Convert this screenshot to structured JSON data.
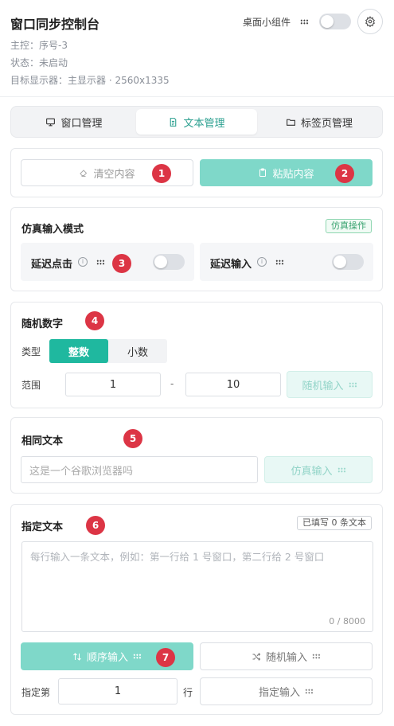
{
  "header": {
    "title": "窗口同步控制台",
    "master": "主控：序号-3",
    "status": "状态：未启动",
    "display": "目标显示器：主显示器 · 2560x1335",
    "widget_label": "桌面小组件"
  },
  "tabs": [
    {
      "label": "窗口管理",
      "icon": "monitor-icon"
    },
    {
      "label": "文本管理",
      "icon": "document-icon",
      "active": true
    },
    {
      "label": "标签页管理",
      "icon": "folder-icon"
    }
  ],
  "actions": {
    "clear_label": "清空内容",
    "paste_label": "粘贴内容"
  },
  "sim_mode": {
    "title": "仿真输入模式",
    "tag": "仿真操作",
    "delay_click": "延迟点击",
    "delay_input": "延迟输入"
  },
  "random_number": {
    "title": "随机数字",
    "type_label": "类型",
    "opt_int": "整数",
    "opt_dec": "小数",
    "range_label": "范围",
    "min": "1",
    "dash": "-",
    "max": "10",
    "button": "随机输入"
  },
  "same_text": {
    "title": "相同文本",
    "placeholder": "这是一个谷歌浏览器吗",
    "button": "仿真输入"
  },
  "specified_text": {
    "title": "指定文本",
    "filled_tag": "已填写 0 条文本",
    "placeholder": "每行输入一条文本，例如：第一行给 1 号窗口，第二行给 2 号窗口",
    "counter": "0 / 8000",
    "seq_button": "顺序输入",
    "rand_button": "随机输入",
    "row_prefix": "指定第",
    "row_value": "1",
    "row_suffix": "行",
    "row_button": "指定输入"
  },
  "badges": [
    "1",
    "2",
    "3",
    "4",
    "5",
    "6",
    "7"
  ],
  "colors": {
    "accent": "#2a9f8f",
    "primary_btn": "#7fd8c9",
    "badge": "#dc3545"
  }
}
